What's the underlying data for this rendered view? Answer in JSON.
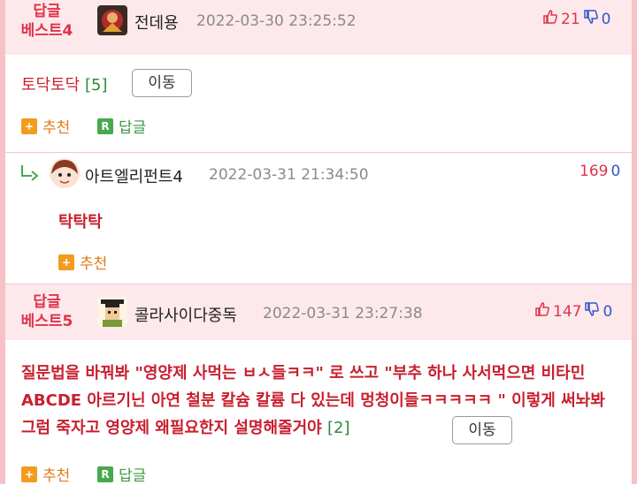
{
  "comments": [
    {
      "badge_line1": "답글",
      "badge_line2": "베스트4",
      "username": "전데용",
      "timestamp": "2022-03-30 23:25:52",
      "up": "21",
      "down": "0",
      "text": "토닥토닥",
      "count": "[5]",
      "move_label": "이동",
      "recommend_label": "추천",
      "reply_label": "답글",
      "avatar_icon": "character-avatar-icon"
    },
    {
      "username": "아트엘리펀트4",
      "timestamp": "2022-03-31 21:34:50",
      "up": "169",
      "down": "0",
      "text": "탁탁탁",
      "recommend_label": "추천",
      "avatar_icon": "cartoon-face-avatar-icon"
    },
    {
      "badge_line1": "답글",
      "badge_line2": "베스트5",
      "username": "콜라사이다중독",
      "timestamp": "2022-03-31 23:27:38",
      "up": "147",
      "down": "0",
      "text": "질문법을 바꿔봐 \"영양제 사먹는 ㅂㅅ들ㅋㅋ\" 로 쓰고 \"부추 하나 사서먹으면 비타민 ABCDE 아르기닌 아연 철분 칼슘 칼륨 다 있는데 멍청이들ㅋㅋㅋㅋㅋ \" 이렇게 써놔봐 그럼 죽자고 영양제 왜필요한지 설명해줄거야",
      "count": "[2]",
      "move_label": "이동",
      "recommend_label": "추천",
      "reply_label": "답글",
      "avatar_icon": "pixel-graduate-avatar-icon"
    }
  ],
  "colors": {
    "accent_red": "#e0334a",
    "header_bg": "#fde9eb",
    "border_pink": "#f6c2c6",
    "thumb_down_blue": "#2e57c9",
    "count_green": "#2f8a3a",
    "recommend_orange": "#f29c1f"
  }
}
